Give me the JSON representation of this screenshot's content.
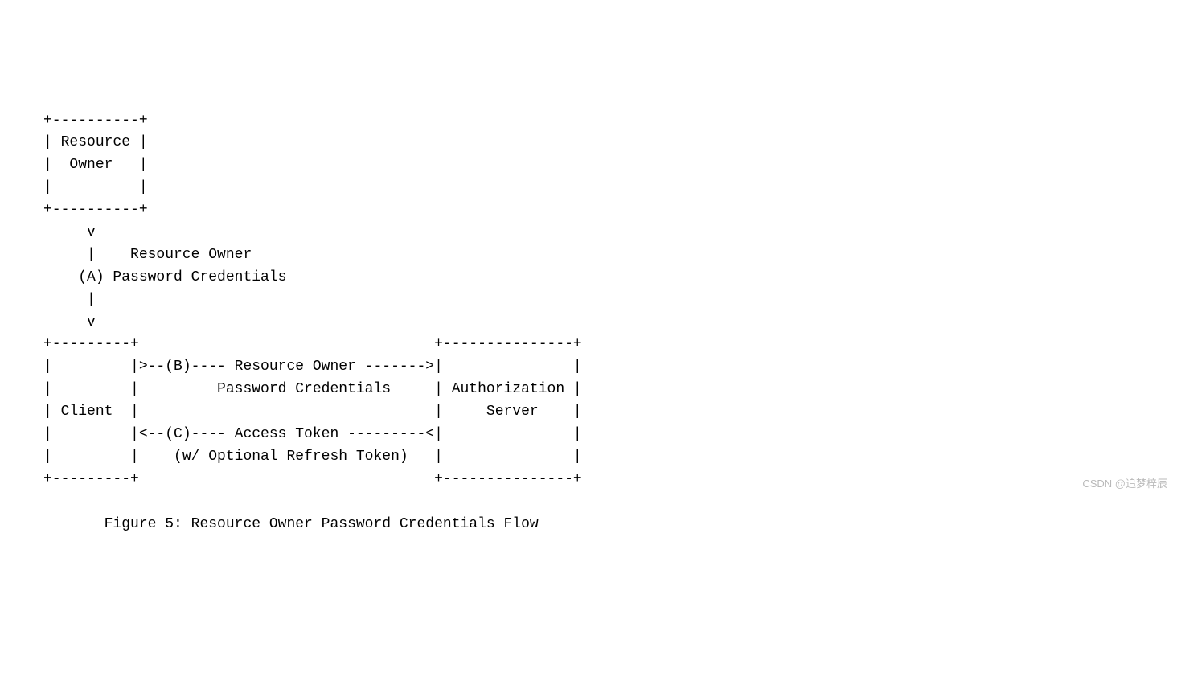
{
  "diagram": {
    "lines": [
      "     +----------+",
      "     | Resource |",
      "     |  Owner   |",
      "     |          |",
      "     +----------+",
      "          v",
      "          |    Resource Owner",
      "         (A) Password Credentials",
      "          |",
      "          v",
      "     +---------+                                  +---------------+",
      "     |         |>--(B)---- Resource Owner ------->|               |",
      "     |         |         Password Credentials     | Authorization |",
      "     | Client  |                                  |     Server    |",
      "     |         |<--(C)---- Access Token ---------<|               |",
      "     |         |    (w/ Optional Refresh Token)   |               |",
      "     +---------+                                  +---------------+",
      "",
      "            Figure 5: Resource Owner Password Credentials Flow"
    ],
    "entities": {
      "resource_owner": "Resource Owner",
      "client": "Client",
      "authorization_server": "Authorization Server"
    },
    "flows": {
      "A": {
        "label": "(A)",
        "text": "Resource Owner Password Credentials",
        "from": "Resource Owner",
        "to": "Client"
      },
      "B": {
        "label": "(B)",
        "text": "Resource Owner Password Credentials",
        "from": "Client",
        "to": "Authorization Server"
      },
      "C": {
        "label": "(C)",
        "text": "Access Token (w/ Optional Refresh Token)",
        "from": "Authorization Server",
        "to": "Client"
      }
    },
    "caption": "Figure 5: Resource Owner Password Credentials Flow"
  },
  "watermark": "CSDN @追梦梓辰"
}
